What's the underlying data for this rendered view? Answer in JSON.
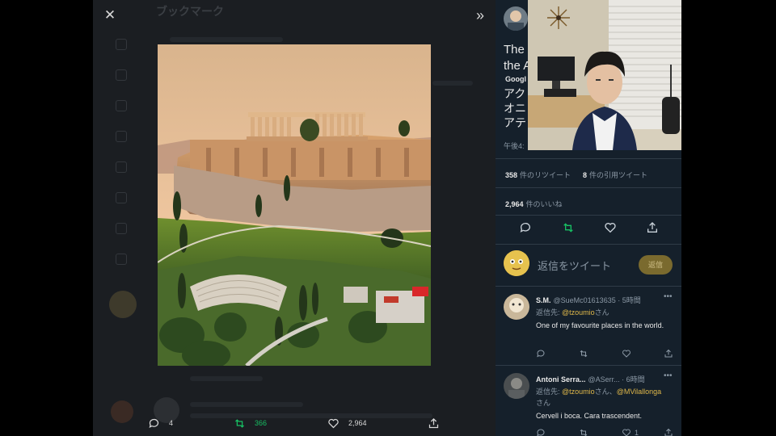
{
  "background_page": {
    "header_title": "ブックマーク"
  },
  "overlay": {
    "close_icon": "close-icon",
    "expand_icon": "expand-icon"
  },
  "photo": {
    "subject": "Acropolis of Athens"
  },
  "actions": {
    "reply_count": "4",
    "retweet_count": "366",
    "like_count": "2,964"
  },
  "tweet": {
    "title_partial": "The\nthe A",
    "source_partial": "Googl",
    "desc_partial": "アク\nオニ\nアテ",
    "time_partial": "午後4:",
    "retweets": "358",
    "retweets_label": "件のリツイート",
    "quotes": "8",
    "quotes_label": "件の引用ツイート",
    "likes": "2,964",
    "likes_label": "件のいいね"
  },
  "compose": {
    "placeholder": "返信をツイート",
    "button_label": "返信"
  },
  "replies": [
    {
      "name": "S.M.",
      "handle": "@SueMc01613635 · 5時間",
      "reply_to_prefix": "返信先: ",
      "mention1": "@tzoumio",
      "mention_suffix": "さん",
      "text": "One of my favourite places in the world."
    },
    {
      "name": "Antoni Serra...",
      "handle": "@ASerr... · 6時間",
      "reply_to_prefix": "返信先: ",
      "mention1": "@tzoumio",
      "mention_mid": "さん、",
      "mention2": "@MVilallonga",
      "mention_suffix": "さん",
      "text": "Cervell i boca. Cara trascendent.",
      "like_count": "1"
    }
  ],
  "colors": {
    "accent": "#e0b84a",
    "retweet_green": "#17bf63",
    "panel_bg": "#15202b"
  }
}
